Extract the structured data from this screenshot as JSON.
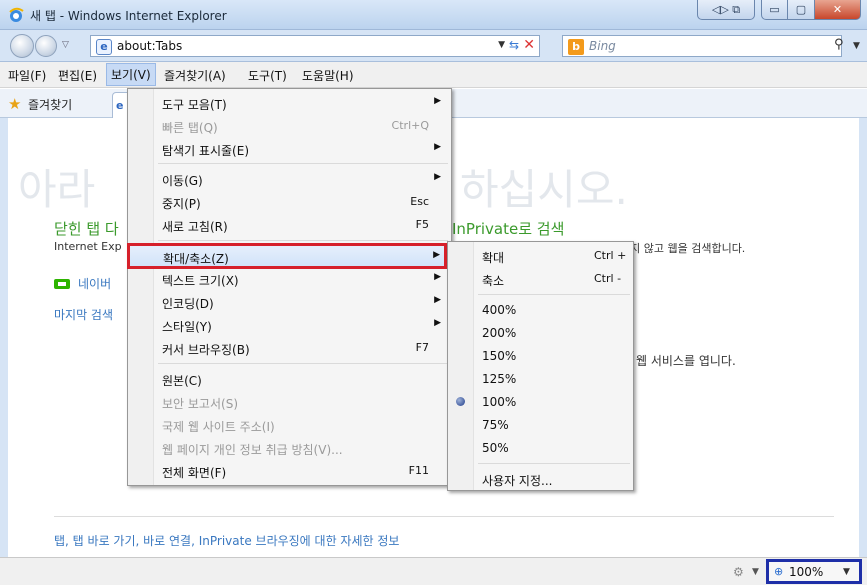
{
  "window": {
    "title": "새 탭 - Windows Internet Explorer",
    "min_symbol": "▭",
    "max_symbol": "▢",
    "close_symbol": "✕",
    "extra_symbol": "◁▷ ⧉"
  },
  "address": {
    "url": "about:Tabs",
    "page_icon": "e",
    "search_placeholder": "Bing",
    "bing_icon": "b"
  },
  "menubar": {
    "items": [
      "파일(F)",
      "편집(E)",
      "보기(V)",
      "즐겨찾기(A)",
      "도구(T)",
      "도움말(H)"
    ]
  },
  "favorites": {
    "label": "즐겨찾기",
    "tab_icon": "e"
  },
  "page": {
    "big_title_left": "아라",
    "big_title_right": "하십시오.",
    "closed_tabs_title": "닫힌 탭 다",
    "closed_tabs_desc": "Internet Exp",
    "inprivate_title": "InPrivate로 검색",
    "inprivate_desc": "하지 않고 웹을 검색합니다.",
    "naver_link": "네이버",
    "last_search": "마지막 검색",
    "web_service": "웹 서비스를 엽니다.",
    "footer_link": "탭, 탭 바로 가기, 바로 연결, InPrivate 브라우징에 대한 자세한 정보"
  },
  "statusbar": {
    "zoom": "100%"
  },
  "view_menu": {
    "items": [
      {
        "label": "도구 모음(T)",
        "shortcut": "",
        "submenu": true,
        "disabled": false
      },
      {
        "label": "빠른 탭(Q)",
        "shortcut": "Ctrl+Q",
        "submenu": false,
        "disabled": true
      },
      {
        "label": "탐색기 표시줄(E)",
        "shortcut": "",
        "submenu": true,
        "disabled": false
      },
      {
        "label": "이동(G)",
        "shortcut": "",
        "submenu": true,
        "disabled": false
      },
      {
        "label": "중지(P)",
        "shortcut": "Esc",
        "submenu": false,
        "disabled": false
      },
      {
        "label": "새로 고침(R)",
        "shortcut": "F5",
        "submenu": false,
        "disabled": false
      },
      {
        "label": "확대/축소(Z)",
        "shortcut": "",
        "submenu": true,
        "disabled": false
      },
      {
        "label": "텍스트 크기(X)",
        "shortcut": "",
        "submenu": true,
        "disabled": false
      },
      {
        "label": "인코딩(D)",
        "shortcut": "",
        "submenu": true,
        "disabled": false
      },
      {
        "label": "스타일(Y)",
        "shortcut": "",
        "submenu": true,
        "disabled": false
      },
      {
        "label": "커서 브라우징(B)",
        "shortcut": "F7",
        "submenu": false,
        "disabled": false
      },
      {
        "label": "원본(C)",
        "shortcut": "",
        "submenu": false,
        "disabled": false
      },
      {
        "label": "보안 보고서(S)",
        "shortcut": "",
        "submenu": false,
        "disabled": true
      },
      {
        "label": "국제 웹 사이트 주소(I)",
        "shortcut": "",
        "submenu": false,
        "disabled": true
      },
      {
        "label": "웹 페이지 개인 정보 취급 방침(V)...",
        "shortcut": "",
        "submenu": false,
        "disabled": true
      },
      {
        "label": "전체 화면(F)",
        "shortcut": "F11",
        "submenu": false,
        "disabled": false
      }
    ]
  },
  "zoom_menu": {
    "items": [
      {
        "label": "확대",
        "shortcut": "Ctrl +"
      },
      {
        "label": "축소",
        "shortcut": "Ctrl -"
      },
      {
        "label": "400%",
        "shortcut": ""
      },
      {
        "label": "200%",
        "shortcut": ""
      },
      {
        "label": "150%",
        "shortcut": ""
      },
      {
        "label": "125%",
        "shortcut": ""
      },
      {
        "label": "100%",
        "shortcut": "",
        "selected": true
      },
      {
        "label": "75%",
        "shortcut": ""
      },
      {
        "label": "50%",
        "shortcut": ""
      },
      {
        "label": "사용자 지정...",
        "shortcut": ""
      }
    ]
  }
}
